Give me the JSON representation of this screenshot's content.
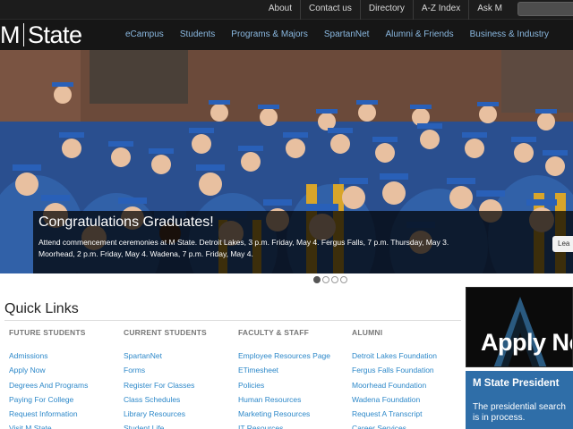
{
  "topbar": {
    "links": [
      "About",
      "Contact us",
      "Directory",
      "A-Z Index",
      "Ask M"
    ]
  },
  "logo": {
    "left": "M",
    "right": "State"
  },
  "mainnav": {
    "items": [
      "eCampus",
      "Students",
      "Programs & Majors",
      "SpartanNet",
      "Alumni & Friends",
      "Business & Industry"
    ]
  },
  "hero": {
    "title": "Congratulations Graduates!",
    "text_line1": "Attend commencement ceremonies at M State. Detroit Lakes, 3 p.m. Friday, May 4. Fergus Falls, 7 p.m. Thursday, May 3.",
    "text_line2": "Moorhead, 2 p.m. Friday, May 4. Wadena, 7 p.m. Friday, May 4.",
    "button_label": "Lea",
    "slides_total": 4,
    "active_slide": 1
  },
  "quicklinks": {
    "title": "Quick Links",
    "columns": [
      {
        "heading": "FUTURE STUDENTS",
        "links": [
          "Admissions",
          "Apply Now",
          "Degrees And Programs",
          "Paying For College",
          "Request Information",
          "Visit M State"
        ]
      },
      {
        "heading": "CURRENT STUDENTS",
        "links": [
          "SpartanNet",
          "Forms",
          "Register For Classes",
          "Class Schedules",
          "Library Resources",
          "Student Life"
        ]
      },
      {
        "heading": "FACULTY & STAFF",
        "links": [
          "Employee Resources Page",
          "ETimesheet",
          "Policies",
          "Human Resources",
          "Marketing Resources",
          "IT Resources"
        ]
      },
      {
        "heading": "ALUMNI",
        "links": [
          "Detroit Lakes Foundation",
          "Fergus Falls Foundation",
          "Moorhead Foundation",
          "Wadena Foundation",
          "Request A Transcript",
          "Career Services"
        ]
      }
    ]
  },
  "ads": {
    "apply": "Apply No",
    "president_title": "M State President",
    "president_line1": "The presidential search",
    "president_line2": "is in process."
  },
  "colors": {
    "nav_link": "#8ab8e0",
    "quicklink": "#2d88c9",
    "ad_blue": "#2f6ea8"
  }
}
